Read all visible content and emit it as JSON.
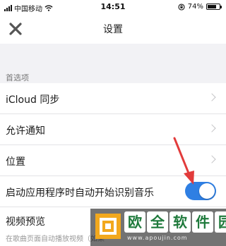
{
  "status_bar": {
    "carrier": "中国移动",
    "time": "14:51",
    "battery_percent": "74%",
    "battery_level": 0.74
  },
  "nav": {
    "title": "设置",
    "close_icon": "close-icon"
  },
  "section": {
    "header": "首选项"
  },
  "rows": [
    {
      "label": "iCloud 同步",
      "control": "chevron"
    },
    {
      "label": "允许通知",
      "control": "chevron"
    },
    {
      "label": "位置",
      "control": "chevron"
    },
    {
      "label": "启动应用程序时自动开始识别音乐",
      "control": "toggle",
      "on": true
    },
    {
      "label": "视频预览",
      "control": "none"
    }
  ],
  "partial_subtitle": "在歌曲页面自动播放视频（如果",
  "colors": {
    "accent": "#2f7fe3",
    "arrow": "#e23b3b",
    "section_bg": "#f2f2f5"
  },
  "watermark": {
    "chars": [
      "欧",
      "全",
      "软",
      "件",
      "园"
    ],
    "url": "www.apoujin.com"
  }
}
